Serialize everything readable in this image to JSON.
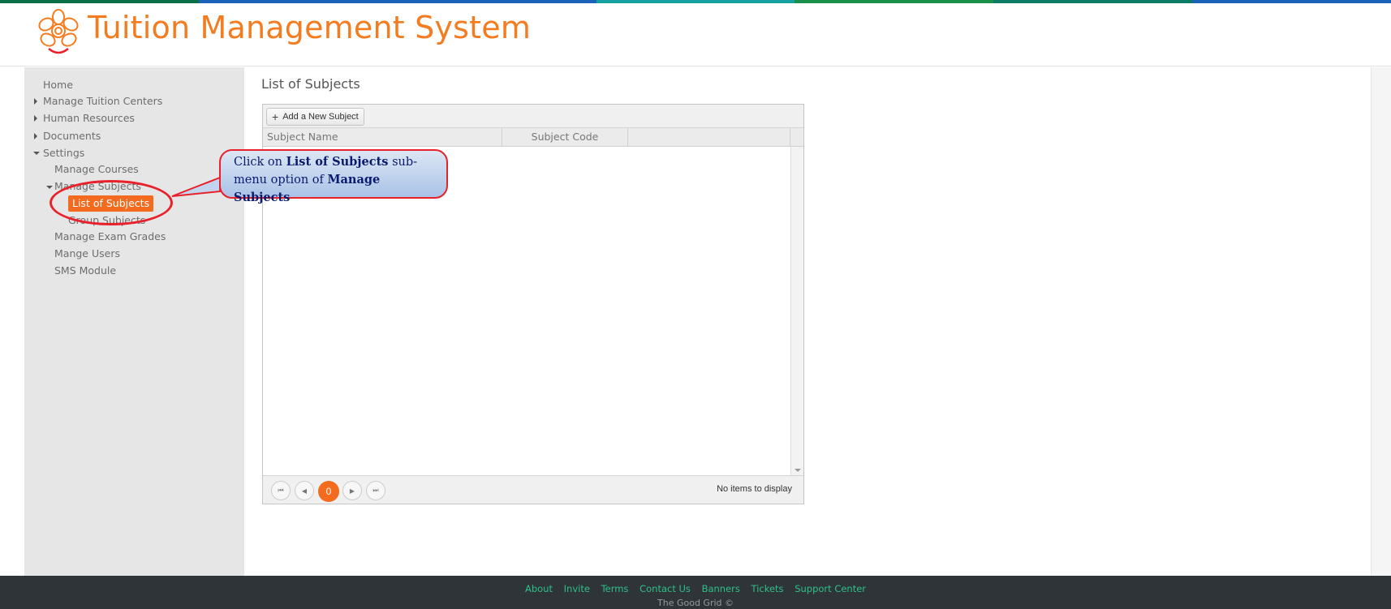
{
  "app": {
    "title": "Tuition Management System"
  },
  "colors": {
    "brand_orange": "#f47c20",
    "active_orange": "#f26b1f",
    "footer_bg": "#2e3437",
    "footer_link": "#2fc08a",
    "callout_border": "#e8212b",
    "top_stripe": [
      "#0b6f47",
      "#1b63b8",
      "#1b63b8",
      "#16a0a0",
      "#1a8f4a",
      "#0e7b64",
      "#1b63b8"
    ]
  },
  "sidebar": {
    "items": [
      {
        "label": "Home"
      },
      {
        "label": "Manage Tuition Centers"
      },
      {
        "label": "Human Resources"
      },
      {
        "label": "Documents"
      },
      {
        "label": "Settings"
      },
      {
        "label": "Manage Courses"
      },
      {
        "label": "Manage Subjects"
      },
      {
        "label": "List of Subjects"
      },
      {
        "label": "Group Subjects"
      },
      {
        "label": "Manage Exam Grades"
      },
      {
        "label": "Mange Users"
      },
      {
        "label": "SMS Module"
      }
    ]
  },
  "main": {
    "page_title": "List of Subjects",
    "add_button_label": "Add a New Subject",
    "columns": [
      "Subject Name",
      "Subject Code"
    ],
    "pager": {
      "first_icon": "first-page-icon",
      "prev_icon": "prev-page-icon",
      "current_page": "0",
      "next_icon": "next-page-icon",
      "last_icon": "last-page-icon",
      "info": "No items to display"
    }
  },
  "callout": {
    "line1_prefix": "Click on ",
    "line1_bold": "List of Subjects",
    "line1_suffix": " sub-",
    "line2_prefix": "menu option of ",
    "line2_bold": "Manage Subjects"
  },
  "footer": {
    "links": [
      "About",
      "Invite",
      "Terms",
      "Contact Us",
      "Banners",
      "Tickets",
      "Support Center"
    ],
    "copyright": "The Good Grid ©"
  }
}
